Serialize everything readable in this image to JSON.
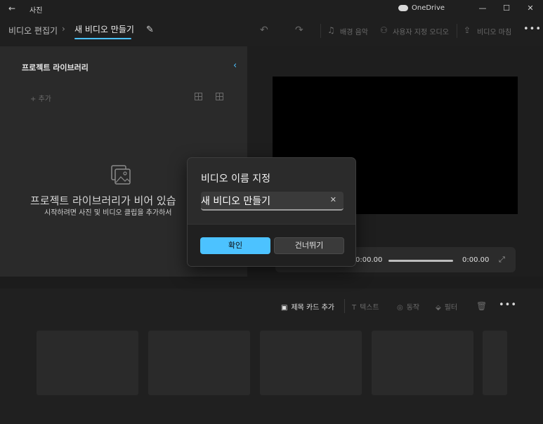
{
  "window": {
    "app_title": "사진",
    "onedrive_label": "OneDrive",
    "back_glyph": "←",
    "minimize_glyph": "—",
    "maximize_glyph": "☐",
    "close_glyph": "✕"
  },
  "toolbar": {
    "breadcrumb_parent": "비디오 편집기",
    "breadcrumb_separator": "›",
    "breadcrumb_current": "새 비디오 만들기",
    "edit_glyph": "✎",
    "undo_glyph": "↶",
    "redo_glyph": "↷",
    "background_music": "배경 음악",
    "custom_audio": "사용자 지정 오디오",
    "finish_video": "비디오 마침",
    "more_glyph": "•••"
  },
  "library": {
    "title": "프로젝트 라이브러리",
    "collapse_glyph": "‹",
    "add_label": "추가",
    "add_glyph": "+",
    "empty_title": "프로젝트 라이브러리가 비어 있습",
    "empty_subtitle": "시작하려면 사진 및 비디오 클립을 추가하서"
  },
  "playback": {
    "current_time": "0:00.00",
    "total_time": "0:00.00",
    "expand_glyph": "⤢"
  },
  "storyboard": {
    "add_title_card": "제목 카드 추가",
    "text": "텍스트",
    "motion": "동작",
    "filter": "필터",
    "more_glyph": "•••"
  },
  "dialog": {
    "title": "비디오 이름 지정",
    "input_value": "새 비디오 만들기",
    "clear_glyph": "✕",
    "ok_label": "확인",
    "skip_label": "건너뛰기"
  },
  "colors": {
    "accent": "#4cc2ff",
    "background": "#1c1c1c"
  }
}
